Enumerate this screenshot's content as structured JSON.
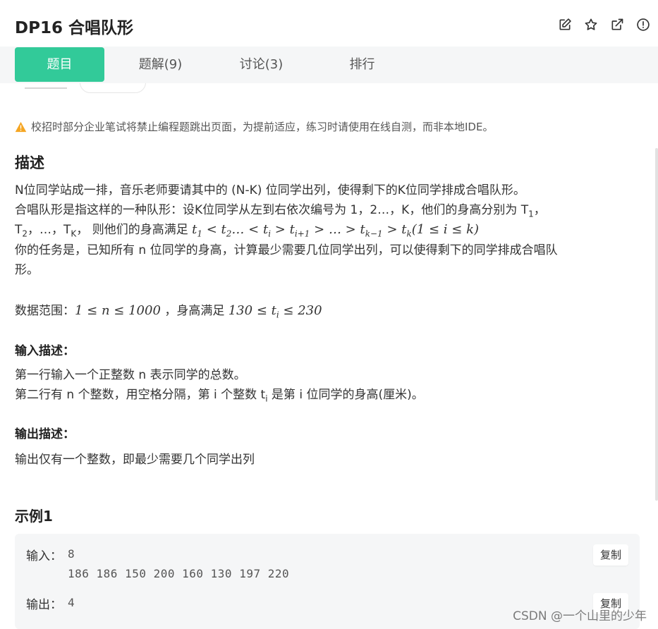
{
  "header": {
    "title": "DP16  合唱队形",
    "icons": [
      "edit-icon",
      "star-icon",
      "external-link-icon",
      "info-icon"
    ]
  },
  "tabs": [
    {
      "label": "题目",
      "active": true
    },
    {
      "label": "题解(9)",
      "active": false
    },
    {
      "label": "讨论(3)",
      "active": false
    },
    {
      "label": "排行",
      "active": false
    }
  ],
  "notice": {
    "text": "校招时部分企业笔试将禁止编程题跳出页面，为提前适应，练习时请使用在线自测，而非本地IDE。",
    "icon": "warning-icon"
  },
  "description": {
    "heading": "描述",
    "line1": "N位同学站成一排，音乐老师要请其中的 (N-K) 位同学出列，使得剩下的K位同学排成合唱队形。",
    "line2_a": "合唱队形是指这样的一种队形：设K位同学从左到右依次编号为 1，2…，K，他们的身高分别为 T",
    "line2_sub": "1",
    "line2_b": "，",
    "line3_a": "T",
    "line3_sub2": "2",
    "line3_b": "，…，T",
    "line3_subK": "K",
    "line3_c": "，   则他们的身高满足 ",
    "line4": "你的任务是，已知所有 n 位同学的身高，计算最少需要几位同学出列，可以使得剩下的同学排成合唱队",
    "line5": "形。",
    "range_label": "数据范围：",
    "range_mid": " ，身高满足 "
  },
  "input_desc": {
    "heading": "输入描述：",
    "line1": "第一行输入一个正整数 n 表示同学的总数。",
    "line2_a": "第二行有 n 个整数，用空格分隔，第 i 个整数 t",
    "line2_sub": "i",
    "line2_b": " 是第 i 位同学的身高(厘米)。"
  },
  "output_desc": {
    "heading": "输出描述：",
    "line1": "输出仅有一个整数，即最少需要几个同学出列"
  },
  "example": {
    "heading": "示例1",
    "input_label": "输入：",
    "input_line1": "8",
    "input_line2": "186 186 150 200 160 130 197 220",
    "output_label": "输出：",
    "output_line1": "4",
    "copy_label": "复制"
  },
  "watermark": "CSDN @一个山里的少年",
  "colors": {
    "accent": "#32ca99",
    "warning": "#f5a623"
  }
}
